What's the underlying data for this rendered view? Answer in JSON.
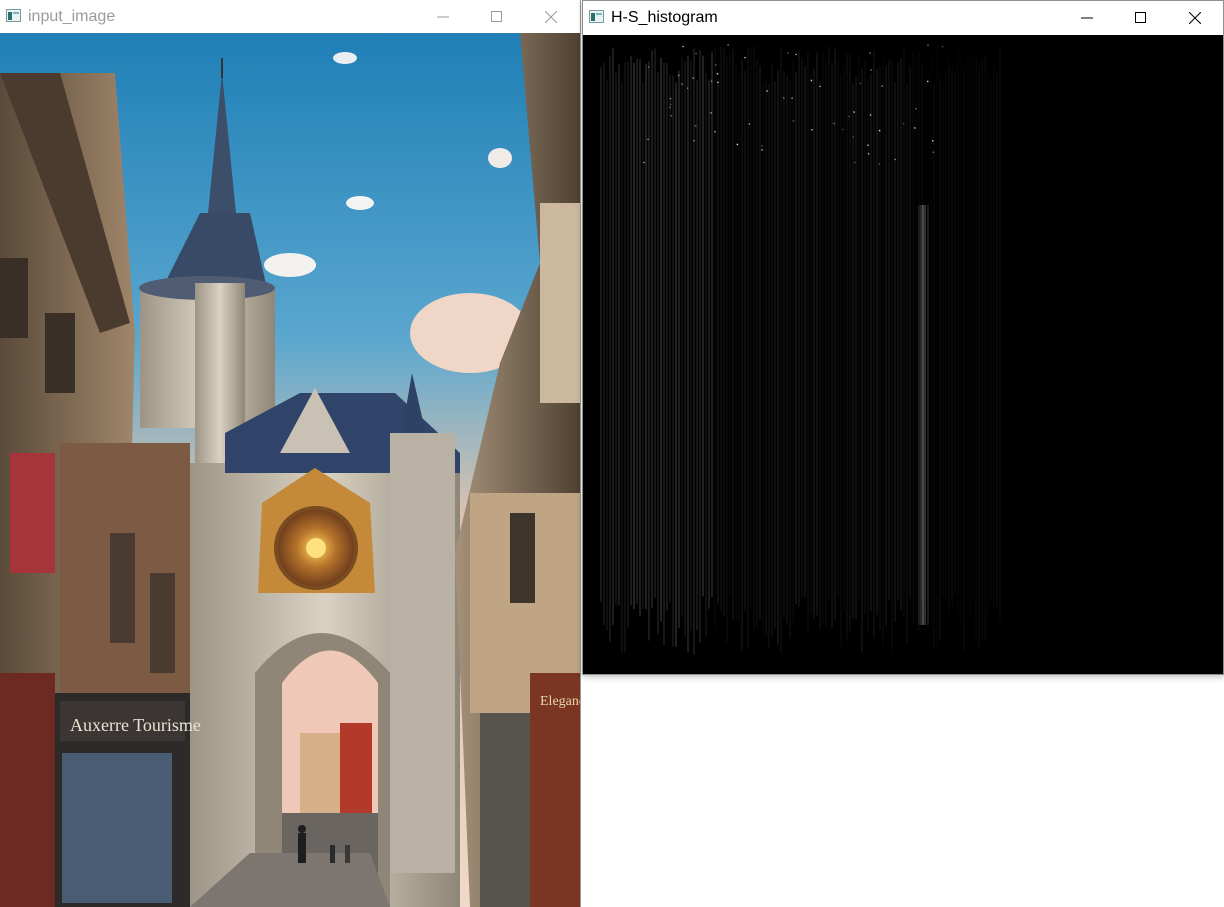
{
  "input_window": {
    "title": "input_image",
    "focused": false,
    "icon": "app-window-icon",
    "controls": [
      "minimize-icon",
      "maximize-icon",
      "close-icon"
    ],
    "photo": {
      "subject": "Auxerre clock tower street scene",
      "shop_sign": "Auxerre Tourisme",
      "shop_sign_right": "Elegance"
    }
  },
  "hist_window": {
    "title": "H-S_histogram",
    "focused": true,
    "icon": "app-window-icon",
    "controls": [
      "minimize-icon",
      "maximize-icon",
      "close-icon"
    ],
    "background_color": "#000000",
    "bright_band_color": "#ffffff"
  }
}
